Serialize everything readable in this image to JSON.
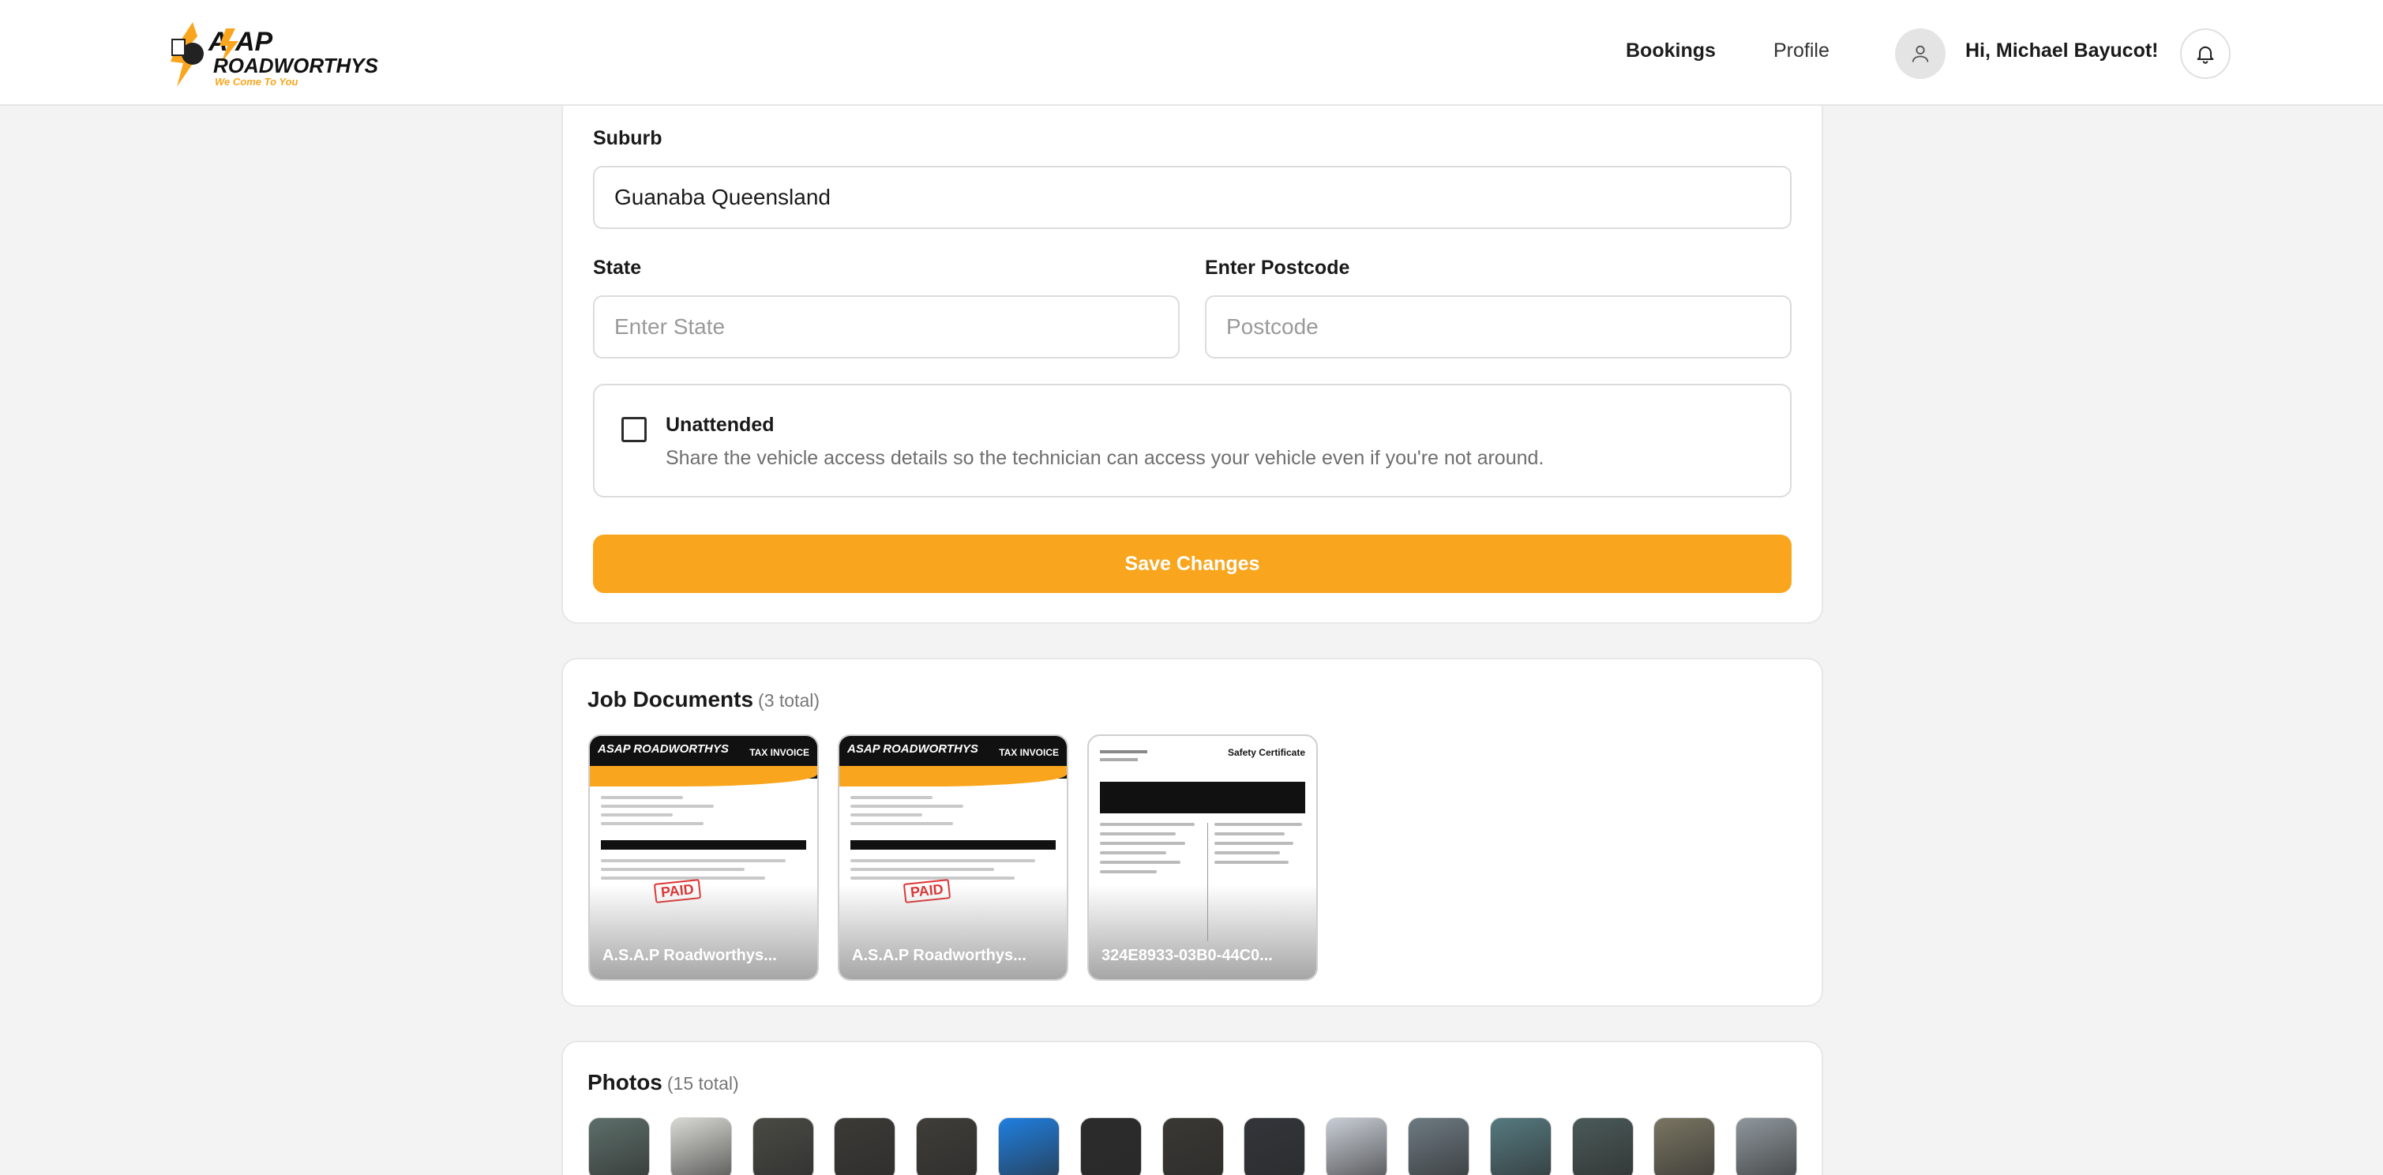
{
  "header": {
    "logo_text": "ASAP ROADWORTHYS",
    "logo_tagline": "We Come To You",
    "nav": {
      "bookings": "Bookings",
      "profile": "Profile"
    },
    "greeting": "Hi, Michael Bayucot!"
  },
  "form": {
    "suburb_label": "Suburb",
    "suburb_value": "Guanaba Queensland",
    "state_label": "State",
    "state_placeholder": "Enter State",
    "postcode_label": "Enter Postcode",
    "postcode_placeholder": "Postcode",
    "unattended_title": "Unattended",
    "unattended_desc": "Share the vehicle access details so the technician can access your vehicle even if you're not around.",
    "unattended_checked": false,
    "save_label": "Save Changes"
  },
  "documents": {
    "title": "Job Documents",
    "count": "(3 total)",
    "items": [
      {
        "name": "A.S.A.P Roadworthys...",
        "type": "TAX INVOICE",
        "stamp": "PAID"
      },
      {
        "name": "A.S.A.P Roadworthys...",
        "type": "TAX INVOICE",
        "stamp": "PAID"
      },
      {
        "name": "324E8933-03B0-44C0...",
        "type": "Safety Certificate",
        "stamp": ""
      }
    ]
  },
  "photos": {
    "title": "Photos",
    "count": "(15 total)",
    "items": [
      {
        "color": "#5d6f6a"
      },
      {
        "color": "#d9d9d4"
      },
      {
        "color": "#4a4a44"
      },
      {
        "color": "#3c3a36"
      },
      {
        "color": "#3f3d38"
      },
      {
        "color": "#1f7fe0"
      },
      {
        "color": "#2b2b2b"
      },
      {
        "color": "#3a3833"
      },
      {
        "color": "#32353a"
      },
      {
        "color": "#c9ced6"
      },
      {
        "color": "#6d7a82"
      },
      {
        "color": "#557a80"
      },
      {
        "color": "#4a5a58"
      },
      {
        "color": "#7a7562"
      },
      {
        "color": "#8f979d"
      }
    ]
  },
  "colors": {
    "accent": "#f9a61e",
    "background": "#f3f3f3"
  }
}
